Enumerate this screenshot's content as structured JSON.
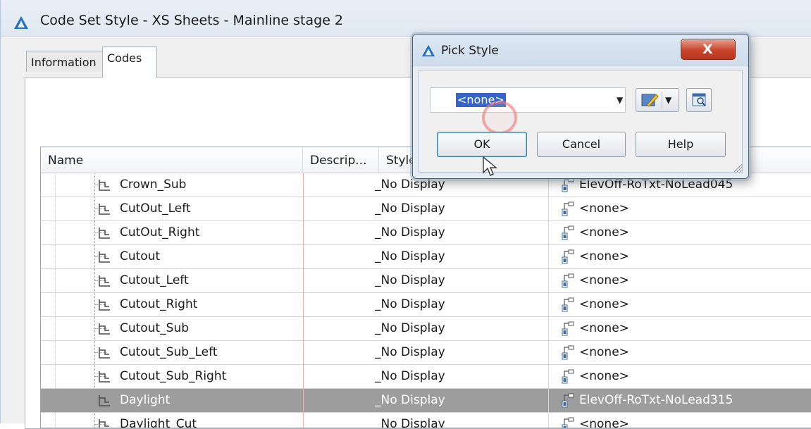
{
  "main_window": {
    "title": "Code Set Style - XS Sheets - Mainline stage 2",
    "tabs": [
      {
        "label": "Information",
        "active": false
      },
      {
        "label": "Codes",
        "active": true
      }
    ]
  },
  "table": {
    "columns": [
      "Name",
      "Descrip...",
      "Style",
      ""
    ],
    "rows": [
      {
        "name": "Crown_Sub",
        "style": "_No Display",
        "label_style": "ElevOff-RoTxt-NoLead045",
        "selected": false
      },
      {
        "name": "CutOut_Left",
        "style": "_No Display",
        "label_style": "<none>",
        "selected": false
      },
      {
        "name": "CutOut_Right",
        "style": "_No Display",
        "label_style": "<none>",
        "selected": false
      },
      {
        "name": "Cutout",
        "style": "_No Display",
        "label_style": "<none>",
        "selected": false
      },
      {
        "name": "Cutout_Left",
        "style": "_No Display",
        "label_style": "<none>",
        "selected": false
      },
      {
        "name": "Cutout_Right",
        "style": "_No Display",
        "label_style": "<none>",
        "selected": false
      },
      {
        "name": "Cutout_Sub",
        "style": "_No Display",
        "label_style": "<none>",
        "selected": false
      },
      {
        "name": "Cutout_Sub_Left",
        "style": "_No Display",
        "label_style": "<none>",
        "selected": false
      },
      {
        "name": "Cutout_Sub_Right",
        "style": "_No Display",
        "label_style": "<none>",
        "selected": false
      },
      {
        "name": "Daylight",
        "style": "_No Display",
        "label_style": "ElevOff-RoTxt-NoLead315",
        "selected": true
      },
      {
        "name": "Daylight_Cut",
        "style": "_No Display",
        "label_style": "<none>",
        "selected": false
      }
    ]
  },
  "dialog": {
    "title": "Pick Style",
    "close_label": "X",
    "selected_style": "<none>",
    "buttons": {
      "ok": "OK",
      "cancel": "Cancel",
      "help": "Help"
    }
  },
  "colors": {
    "selection_row": "#9d9d9d",
    "selection_text_highlight": "#3565c8",
    "close_button": "#c9432a",
    "app_logo": "#1f6fc3"
  },
  "icons": [
    "autocad-logo-icon",
    "code-item-icon",
    "label-style-icon",
    "edit-style-icon",
    "preview-icon",
    "close-icon",
    "chevron-down-icon",
    "mouse-cursor-icon"
  ]
}
